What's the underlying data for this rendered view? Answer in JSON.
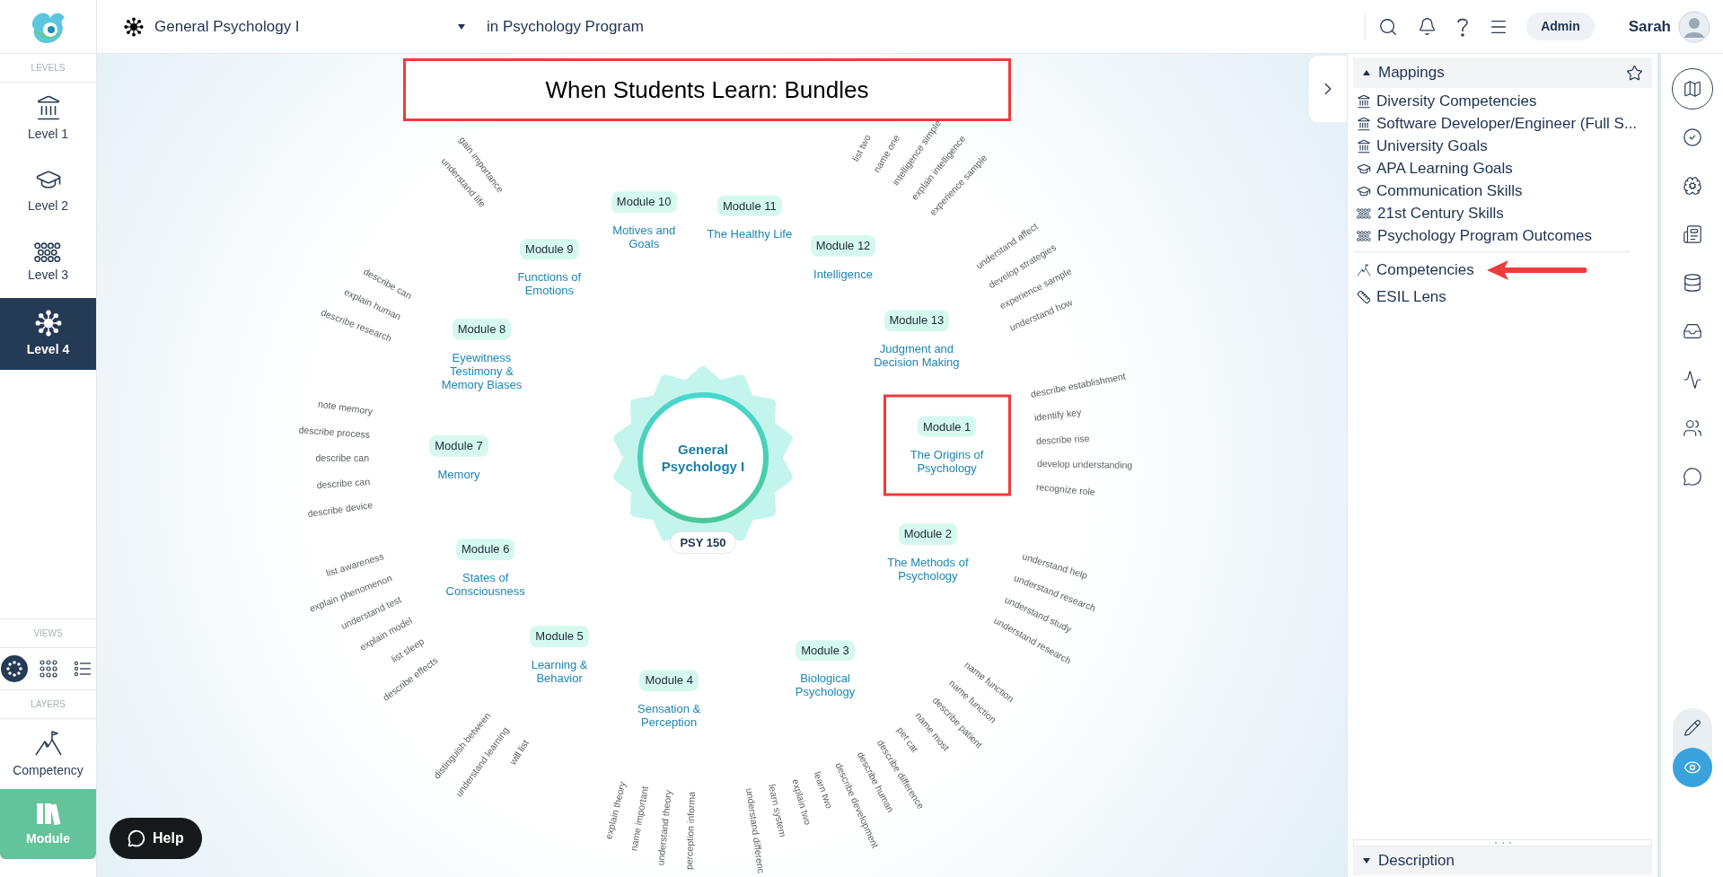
{
  "header": {
    "course_title": "General Psychology I",
    "program": "in Psychology Program",
    "role": "Admin",
    "user_name": "Sarah"
  },
  "sidebar": {
    "levels_heading": "LEVELS",
    "levels": [
      {
        "label": "Level 1",
        "selected": false
      },
      {
        "label": "Level 2",
        "selected": false
      },
      {
        "label": "Level 3",
        "selected": false
      },
      {
        "label": "Level 4",
        "selected": true
      }
    ],
    "views_heading": "VIEWS",
    "views": [
      {
        "selected": true
      },
      {
        "selected": false
      },
      {
        "selected": false
      }
    ],
    "layers_heading": "LAYERS",
    "layers": [
      {
        "label": "Competency",
        "selected": false
      },
      {
        "label": "Module",
        "selected": true
      }
    ]
  },
  "help_button": "Help",
  "canvas": {
    "title": "When Students Learn: Bundles",
    "hub": {
      "title": "General Psychology I",
      "code": "PSY 150"
    },
    "modules": [
      {
        "badge": "Module 10",
        "title": "Motives and Goals",
        "highlighted": false
      },
      {
        "badge": "Module 11",
        "title": "The Healthy Life",
        "highlighted": false
      },
      {
        "badge": "Module 12",
        "title": "Intelligence",
        "highlighted": false,
        "outcomes": [
          "list two",
          "name one",
          "intelligence simple",
          "explain intelligence",
          "experience sample"
        ]
      },
      {
        "badge": "Module 9",
        "title": "Functions of Emotions",
        "highlighted": false,
        "outcomes": [
          "understand life",
          "gain importance"
        ]
      },
      {
        "badge": "Module 13",
        "title": "Judgment and Decision Making",
        "highlighted": false,
        "outcomes": [
          "understand affect",
          "develop strategies",
          "experience sample",
          "understand how"
        ]
      },
      {
        "badge": "Module 8",
        "title": "Eyewitness Testimony & Memory Biases",
        "highlighted": false,
        "outcomes": [
          "describe research",
          "explain human",
          "describe can"
        ]
      },
      {
        "badge": "Module 1",
        "title": "The Origins of Psychology",
        "highlighted": true,
        "outcomes": [
          "describe establishment",
          "identify key",
          "describe rise",
          "develop understanding",
          "recognize role"
        ]
      },
      {
        "badge": "Module 7",
        "title": "Memory",
        "highlighted": false,
        "outcomes": [
          "describe device",
          "describe can",
          "describe can",
          "describe process",
          "note memory"
        ]
      },
      {
        "badge": "Module 2",
        "title": "The Methods of Psychology",
        "highlighted": false,
        "outcomes": [
          "understand help",
          "understand research",
          "understand study",
          "understand research"
        ]
      },
      {
        "badge": "Module 6",
        "title": "States of Consciousness",
        "highlighted": false,
        "outcomes": [
          "describe effects",
          "list sleep",
          "explain model",
          "understand test",
          "explain phenomenon",
          "list awareness"
        ]
      },
      {
        "badge": "Module 5",
        "title": "Learning & Behavior",
        "highlighted": false,
        "outcomes": [
          "will list",
          "understand learning",
          "distinguish between"
        ]
      },
      {
        "badge": "Module 3",
        "title": "Biological Psychology",
        "highlighted": false,
        "outcomes": [
          "name function",
          "name function",
          "describe patient",
          "name most",
          "pet cat",
          "describe difference",
          "describe human",
          "describe development",
          "learn two",
          "explain two",
          "learn system",
          "understand differenc"
        ]
      },
      {
        "badge": "Module 4",
        "title": "Sensation & Perception",
        "highlighted": false,
        "outcomes": [
          "perception informa",
          "understand theory",
          "name important",
          "explain theory"
        ]
      }
    ]
  },
  "right_panel": {
    "mappings": {
      "title": "Mappings",
      "expanded": true,
      "items": [
        "Diversity Competencies",
        "Software Developer/Engineer (Full S...",
        "University Goals",
        "APA Learning Goals",
        "Communication Skills",
        "21st Century Skills",
        "Psychology Program Outcomes"
      ],
      "layers": [
        {
          "label": "Competencies",
          "annotated": true
        },
        {
          "label": "ESIL Lens",
          "annotated": false
        }
      ]
    },
    "description": {
      "title": "Description",
      "expanded": false
    }
  },
  "tool_rail": {
    "tools": [
      {
        "selected": true
      },
      {
        "selected": false
      },
      {
        "selected": false
      },
      {
        "selected": false
      },
      {
        "selected": false
      },
      {
        "selected": false
      },
      {
        "selected": false
      },
      {
        "selected": false
      },
      {
        "selected": false
      }
    ],
    "modes": [
      {
        "selected": false
      },
      {
        "selected": true
      }
    ]
  }
}
